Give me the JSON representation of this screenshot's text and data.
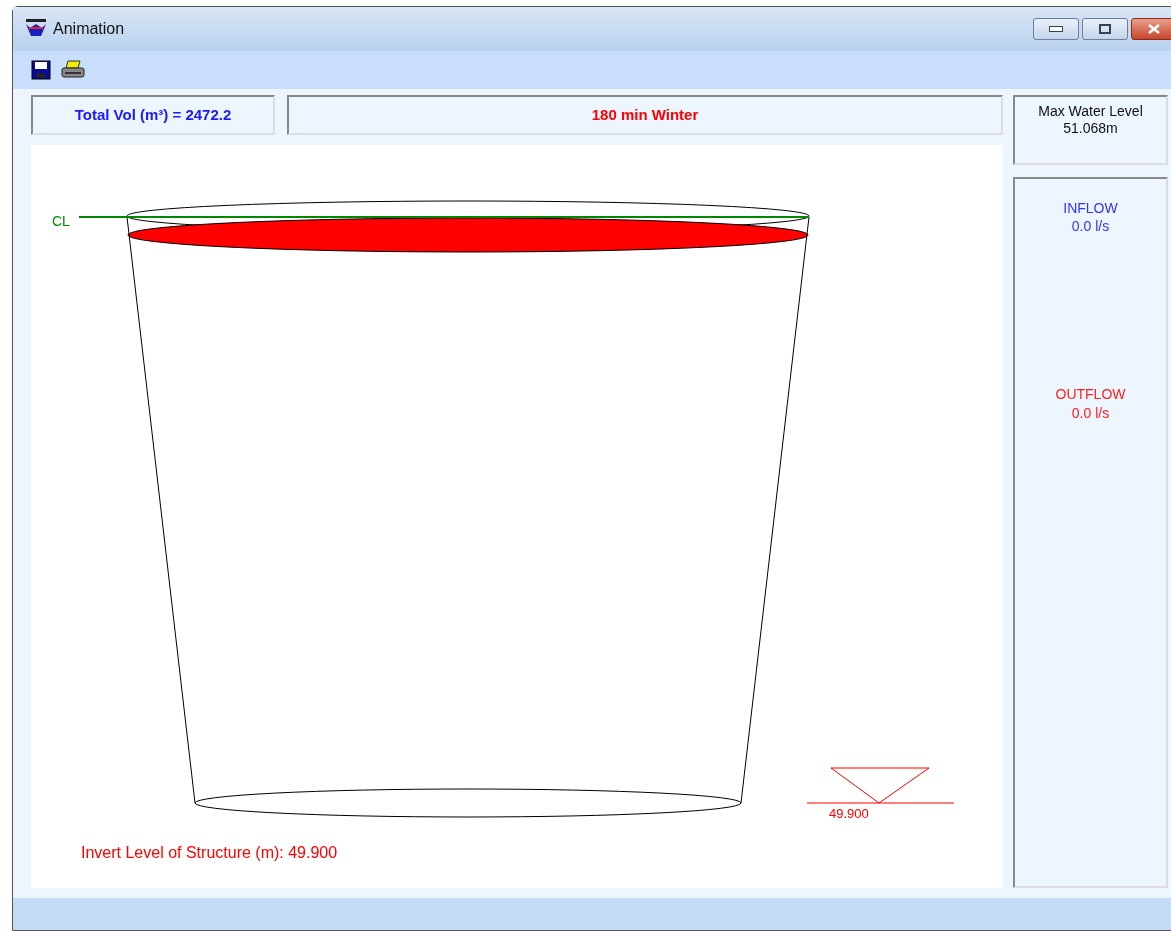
{
  "window": {
    "title": "Animation"
  },
  "total_volume": "Total Vol (m³) = 2472.2",
  "scenario": "180 min Winter",
  "max_water_level": {
    "label": "Max Water Level",
    "value": "51.068m"
  },
  "inflow": {
    "label": "INFLOW",
    "value": "0.0 l/s"
  },
  "outflow": {
    "label": "OUTFLOW",
    "value": "0.0 l/s"
  },
  "drawing": {
    "cl_label": "CL",
    "level_label": "49.900",
    "invert_text": "Invert Level of Structure (m): 49.900"
  }
}
